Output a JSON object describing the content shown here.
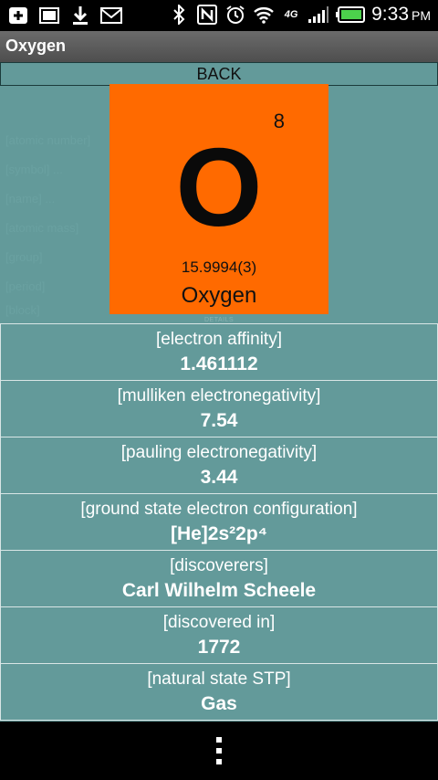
{
  "status_bar": {
    "time": "9:33",
    "ampm": "PM",
    "lte_label": "4G",
    "icons_left": [
      "add-box-icon",
      "gallery-icon",
      "download-icon",
      "gmail-icon"
    ],
    "icons_right": [
      "bluetooth-icon",
      "nfc-icon",
      "alarm-icon",
      "wifi-icon",
      "lte-icon",
      "signal-icon",
      "battery-icon"
    ]
  },
  "action_bar": {
    "title": "Oxygen"
  },
  "back_button": {
    "label": "BACK"
  },
  "ghost_list": [
    "[atomic number]",
    "[symbol] ...",
    "[name] ...",
    "[atomic mass]",
    "[group]",
    "[period]",
    "[block]"
  ],
  "element": {
    "atomic_number": "8",
    "symbol": "O",
    "atomic_mass": "15.9994(3)",
    "name": "Oxygen",
    "tile_color": "#ff6a00",
    "details_label": "DETAILS"
  },
  "properties": [
    {
      "label": "[electron affinity]",
      "value": "1.461112"
    },
    {
      "label": "[mulliken electronegativity]",
      "value": "7.54"
    },
    {
      "label": "[pauling electronegativity]",
      "value": "3.44"
    },
    {
      "label": "[ground state electron configuration]",
      "value": "[He]2s²2p⁴"
    },
    {
      "label": "[discoverers]",
      "value": "Carl Wilhelm Scheele"
    },
    {
      "label": "[discovered in]",
      "value": "1772"
    },
    {
      "label": "[natural state STP]",
      "value": "Gas"
    }
  ],
  "colors": {
    "background": "#639a9a",
    "text": "#ffffff"
  },
  "nav_bar": {
    "menu_icon": "overflow-menu-icon"
  }
}
